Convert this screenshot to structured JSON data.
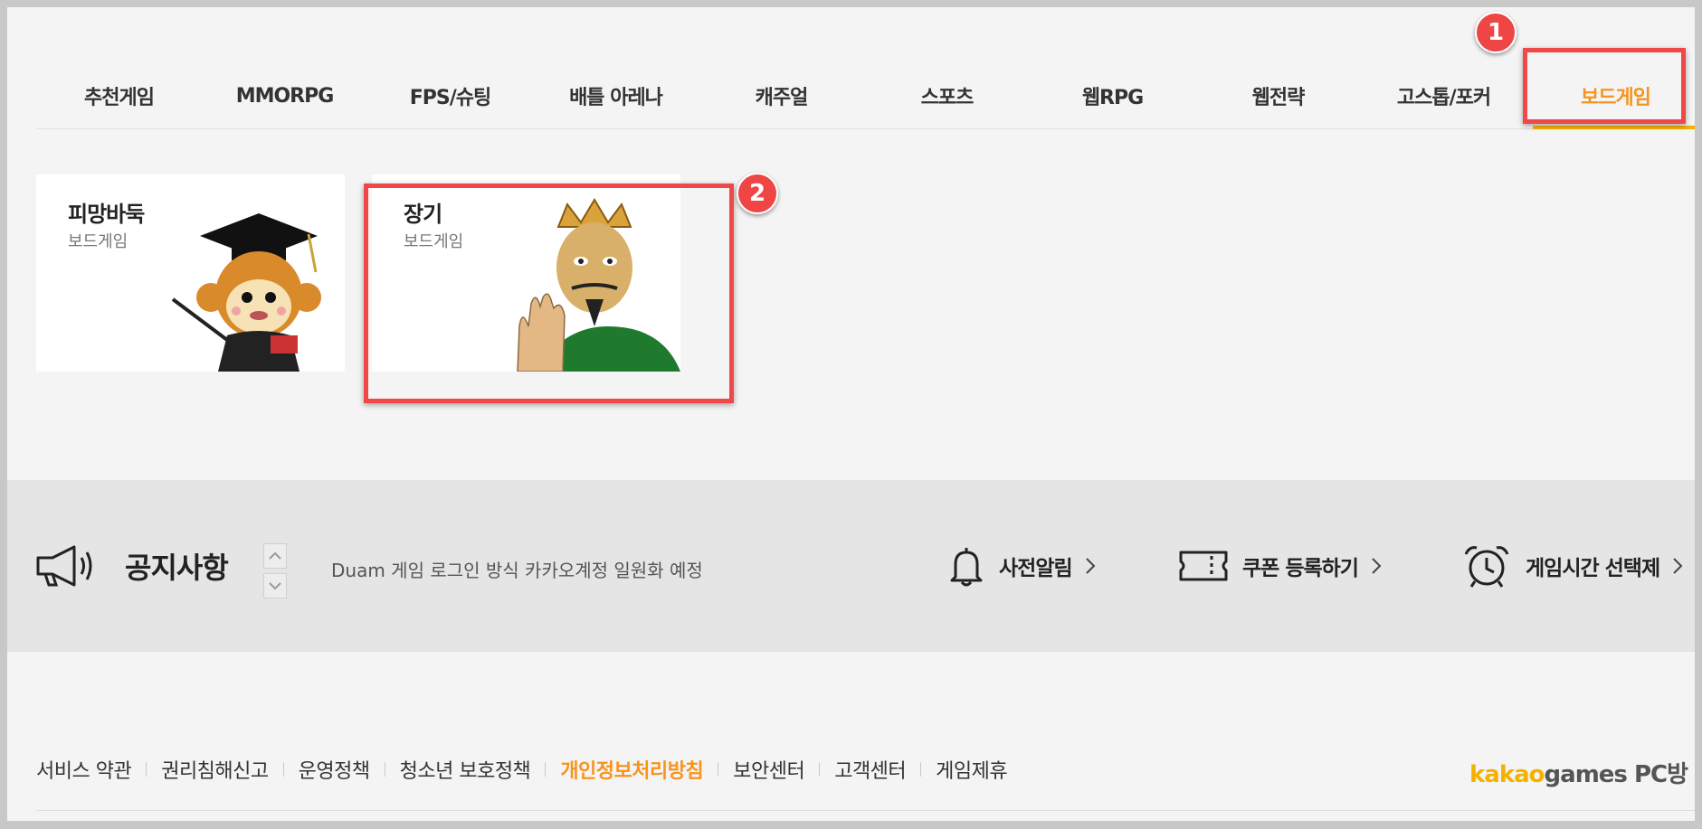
{
  "tabs": [
    {
      "label": "추천게임",
      "active": false
    },
    {
      "label": "MMORPG",
      "active": false
    },
    {
      "label": "FPS/슈팅",
      "active": false
    },
    {
      "label": "배틀 아레나",
      "active": false
    },
    {
      "label": "캐주얼",
      "active": false
    },
    {
      "label": "스포츠",
      "active": false
    },
    {
      "label": "웹RPG",
      "active": false
    },
    {
      "label": "웹전략",
      "active": false
    },
    {
      "label": "고스톱/포커",
      "active": false
    },
    {
      "label": "보드게임",
      "active": true
    }
  ],
  "games": [
    {
      "title": "피망바둑",
      "genre": "보드게임"
    },
    {
      "title": "장기",
      "genre": "보드게임"
    }
  ],
  "annotations": {
    "one": "1",
    "two": "2"
  },
  "notice": {
    "title": "공지사항",
    "text": "Duam 게임 로그인 방식 카카오계정 일원화 예정"
  },
  "quick_links": {
    "alert": "사전알림",
    "coupon": "쿠폰 등록하기",
    "playtime": "게임시간 선택제"
  },
  "footer": {
    "links": [
      "서비스 약관",
      "권리침해신고",
      "운영정책",
      "청소년 보호정책",
      "개인정보처리방침",
      "보안센터",
      "고객센터",
      "게임제휴"
    ],
    "brand_kakao": "kakao",
    "brand_games": "games PC방"
  },
  "colors": {
    "accent": "#f7941d",
    "annotation": "#f04848",
    "tab_underline": "#f6b100"
  }
}
